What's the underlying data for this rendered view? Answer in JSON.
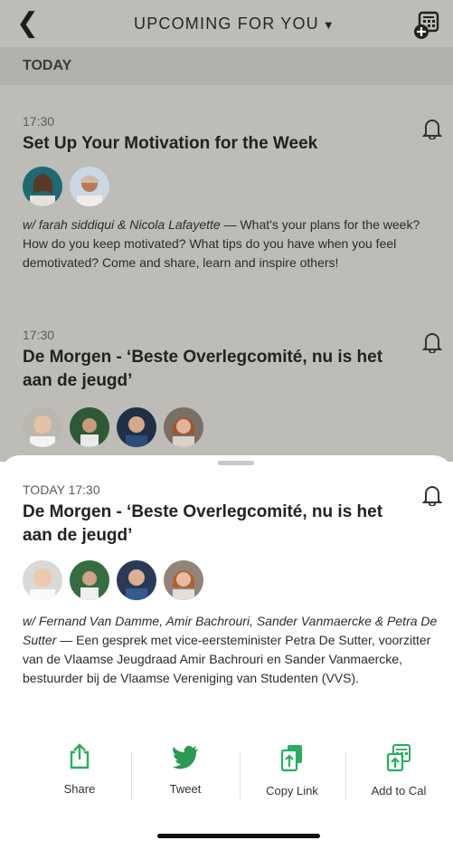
{
  "header": {
    "title": "UPCOMING FOR YOU",
    "caret": "▼",
    "back_icon": "chevron-left-icon",
    "calendar_icon": "calendar-add-icon"
  },
  "today_label": "TODAY",
  "events": [
    {
      "time": "17:30",
      "title": "Set Up Your Motivation for the Week",
      "hosts": "w/ farah siddiqui & Nicola Lafayette",
      "description": " — What's your plans for the week? How do you keep motivated? What tips do you have when you feel demotivated? Come and share, learn and inspire others!"
    },
    {
      "time": "17:30",
      "title": "De Morgen - ‘Beste Overlegcomité, nu is het aan de jeugd’"
    }
  ],
  "sheet": {
    "time": "TODAY 17:30",
    "title": "De Morgen - ‘Beste Overlegcomité, nu is het aan de jeugd’",
    "hosts": "w/ Fernand Van Damme, Amir Bachrouri, Sander Vanmaercke & Petra De Sutter",
    "description": " — Een gesprek met vice-eersteminister Petra De Sutter, voorzitter van de Vlaamse Jeugdraad Amir Bachrouri en Sander Vanmaercke, bestuurder bij de Vlaamse Vereniging van Studenten (VVS)."
  },
  "actions": [
    {
      "label": "Share",
      "icon": "share-icon"
    },
    {
      "label": "Tweet",
      "icon": "twitter-bird-icon"
    },
    {
      "label": "Copy Link",
      "icon": "copy-link-icon"
    },
    {
      "label": "Add to Cal",
      "icon": "add-to-calendar-icon"
    }
  ],
  "colors": {
    "accent_green": "#27ae60",
    "twitter_green": "#2a9a52",
    "dim_overlay": "#bdbcb6"
  }
}
